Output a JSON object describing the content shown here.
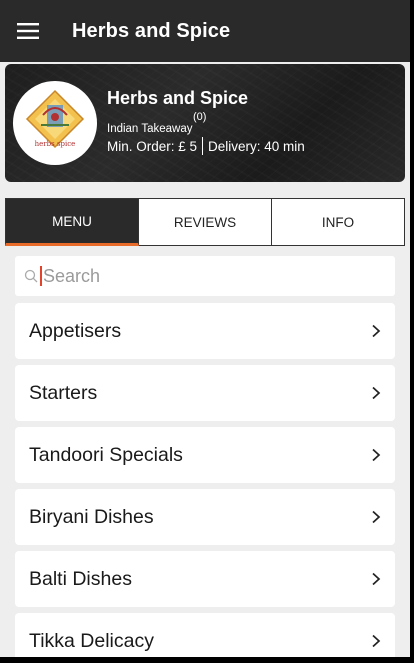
{
  "appbar": {
    "title": "Herbs and Spice",
    "menu_icon": "hamburger-menu-icon"
  },
  "restaurant": {
    "name": "Herbs and Spice",
    "rating": "(0)",
    "cuisine": "Indian Takeaway",
    "min_order": "Min. Order: £ 5",
    "delivery": "Delivery: 40 min",
    "logo_text": "herbs spice"
  },
  "tabs": [
    {
      "label": "MENU",
      "active": true
    },
    {
      "label": "REVIEWS",
      "active": false
    },
    {
      "label": "INFO",
      "active": false
    }
  ],
  "search": {
    "placeholder": "Search",
    "value": ""
  },
  "categories": [
    {
      "label": "Appetisers"
    },
    {
      "label": "Starters"
    },
    {
      "label": "Tandoori Specials"
    },
    {
      "label": "Biryani Dishes"
    },
    {
      "label": "Balti Dishes"
    },
    {
      "label": "Tikka Delicacy"
    }
  ],
  "colors": {
    "appbar": "#2a2a2a",
    "accent": "#e86b2a",
    "background": "#eeeeee"
  }
}
